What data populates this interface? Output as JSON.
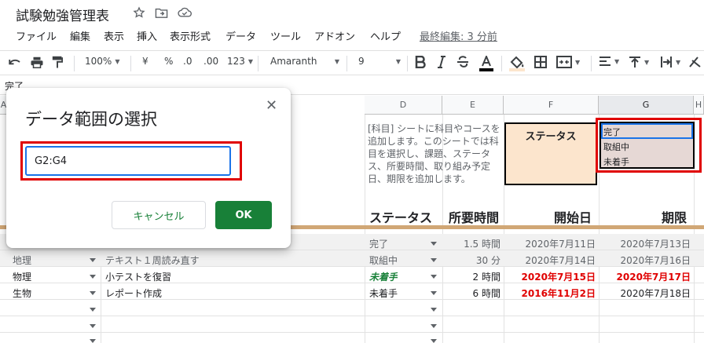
{
  "title": "試験勉強管理表",
  "menu": [
    "ファイル",
    "編集",
    "表示",
    "挿入",
    "表示形式",
    "データ",
    "ツール",
    "アドオン",
    "ヘルプ"
  ],
  "last_edit": "最終編集: 3 分前",
  "toolbar": {
    "zoom": "100%",
    "currency": "¥",
    "percent": "%",
    "dec_less": ".0",
    "dec_more": ".00",
    "format": "123",
    "font": "Amaranth",
    "size": "9"
  },
  "formula_value": "完了",
  "columns": [
    "A",
    "D",
    "E",
    "F",
    "G",
    "H"
  ],
  "description": "[科目] シートに科目やコースを追加します。このシートでは科目を選択し、課題、ステータス、所要時間、取り組み予定日、期限を追加します。",
  "status_label": "ステータス",
  "status_options": [
    "完了",
    "取組中",
    "未着手"
  ],
  "headers": {
    "status": "ステータス",
    "duration": "所要時間",
    "start": "開始日",
    "due": "期限"
  },
  "rows": [
    {
      "subject": "",
      "task": "",
      "status": "完了",
      "duration": "1.5 時間",
      "start": "2020年7月11日",
      "due": "2020年7月13日"
    },
    {
      "subject": "地理",
      "task": "テキスト１周読み直す",
      "status": "取組中",
      "duration": "30 分",
      "start": "2020年7月14日",
      "due": "2020年7月16日"
    },
    {
      "subject": "物理",
      "task": "小テストを復習",
      "status": "未着手",
      "duration": "2 時間",
      "start": "2020年7月15日",
      "due": "2020年7月17日"
    },
    {
      "subject": "生物",
      "task": "レポート作成",
      "status": "未着手",
      "duration": "6 時間",
      "start": "2016年11月2日",
      "due": "2020年7月18日"
    }
  ],
  "dialog": {
    "title": "データ範囲の選択",
    "range": "G2:G4",
    "cancel": "キャンセル",
    "ok": "OK"
  }
}
